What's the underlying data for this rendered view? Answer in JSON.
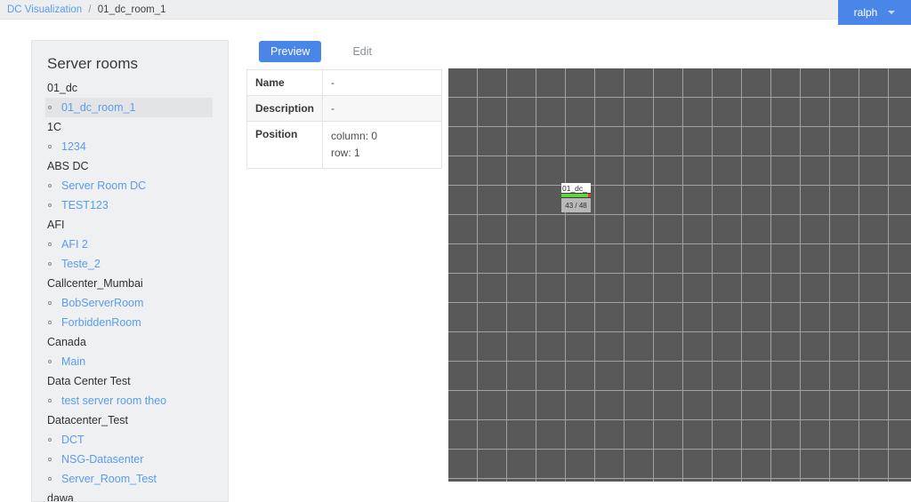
{
  "breadcrumb": {
    "root": "DC Visualization",
    "separator": "/",
    "current": "01_dc_room_1"
  },
  "user_menu": {
    "label": "ralph",
    "caret_icon": "chevron-down-icon"
  },
  "sidebar": {
    "title": "Server rooms",
    "groups": [
      {
        "name": "01_dc",
        "rooms": [
          {
            "label": "01_dc_room_1",
            "selected": true
          }
        ]
      },
      {
        "name": "1C",
        "rooms": [
          {
            "label": "1234",
            "selected": false
          }
        ]
      },
      {
        "name": "ABS DC",
        "rooms": [
          {
            "label": "Server Room DC",
            "selected": false
          },
          {
            "label": "TEST123",
            "selected": false
          }
        ]
      },
      {
        "name": "AFI",
        "rooms": [
          {
            "label": "AFI 2",
            "selected": false
          },
          {
            "label": "Teste_2",
            "selected": false
          }
        ]
      },
      {
        "name": "Callcenter_Mumbai",
        "rooms": [
          {
            "label": "BobServerRoom",
            "selected": false
          },
          {
            "label": "ForbiddenRoom",
            "selected": false
          }
        ]
      },
      {
        "name": "Canada",
        "rooms": [
          {
            "label": "Main",
            "selected": false
          }
        ]
      },
      {
        "name": "Data Center Test",
        "rooms": [
          {
            "label": "test server room theo",
            "selected": false
          }
        ]
      },
      {
        "name": "Datacenter_Test",
        "rooms": [
          {
            "label": "DCT",
            "selected": false
          },
          {
            "label": "NSG-Datasenter",
            "selected": false
          },
          {
            "label": "Server_Room_Test",
            "selected": false
          }
        ]
      },
      {
        "name": "dawa",
        "rooms": []
      }
    ]
  },
  "tabs": [
    {
      "label": "Preview",
      "active": true
    },
    {
      "label": "Edit",
      "active": false
    }
  ],
  "properties": {
    "name_label": "Name",
    "name_value": "-",
    "description_label": "Description",
    "description_value": "-",
    "position_label": "Position",
    "position_column": "column: 0",
    "position_row": "row: 1"
  },
  "canvas": {
    "rack": {
      "name": "01_dc_",
      "count": "43 / 48",
      "used": 43,
      "total": 48,
      "fill_percent": 90,
      "fill_color": "#62d442",
      "empty_color": "#d84040"
    },
    "grid": {
      "cell_size": 33,
      "cell_color": "#595959",
      "line_color": "#a2a2a2"
    }
  },
  "colors": {
    "accent": "#4a86e8",
    "link": "#5b9bf0",
    "topbar_bg": "#eceeef",
    "panel_bg": "#eff0f1"
  }
}
